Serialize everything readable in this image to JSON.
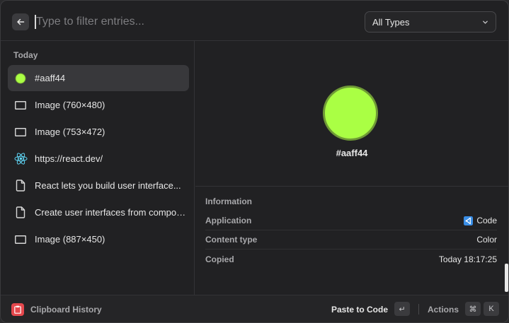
{
  "search": {
    "placeholder": "Type to filter entries..."
  },
  "type_filter": {
    "selected": "All Types"
  },
  "list": {
    "section": "Today",
    "items": [
      {
        "icon": "color-dot-icon",
        "label": "#aaff44",
        "selected": true
      },
      {
        "icon": "image-icon",
        "label": "Image (760×480)"
      },
      {
        "icon": "image-icon",
        "label": "Image (753×472)"
      },
      {
        "icon": "react-icon",
        "label": "https://react.dev/"
      },
      {
        "icon": "text-file-icon",
        "label": "React lets you build user interface..."
      },
      {
        "icon": "text-file-icon",
        "label": "Create user interfaces from compon..."
      },
      {
        "icon": "image-icon",
        "label": "Image (887×450)"
      }
    ]
  },
  "preview": {
    "color": "#aaff44",
    "label": "#aaff44"
  },
  "info": {
    "title": "Information",
    "rows": [
      {
        "key": "Application",
        "value": "Code",
        "icon": "vscode-icon"
      },
      {
        "key": "Content type",
        "value": "Color"
      },
      {
        "key": "Copied",
        "value": "Today 18:17:25"
      }
    ]
  },
  "footer": {
    "app_name": "Clipboard History",
    "primary_action": "Paste to Code",
    "primary_key": "↵",
    "actions_label": "Actions",
    "actions_keys": [
      "⌘",
      "K"
    ]
  },
  "colors": {
    "accent_red": "#e5484d",
    "swatch": "#aaff44",
    "vscode_blue": "#3a8ee6"
  }
}
